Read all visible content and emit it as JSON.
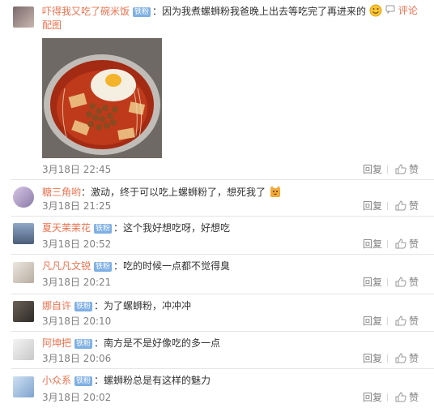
{
  "comments": [
    {
      "username": "吓得我又吃了碗米饭",
      "badge": "铁粉",
      "text": "因为我煮螺蛳粉我爸晚上出去等吃完了再进来的",
      "actions_top": "评论",
      "pic_link": "配图",
      "time": "3月18日 22:45",
      "reply": "回复",
      "like": "赞"
    },
    {
      "username": "糖三角哟",
      "badge": "",
      "text": "激动，终于可以吃上螺蛳粉了，想死我了",
      "time": "3月18日 21:25",
      "reply": "回复",
      "like": "赞"
    },
    {
      "username": "夏天茉茉花",
      "badge": "铁粉",
      "text": "这个我好想吃呀，好想吃",
      "time": "3月18日 20:52",
      "reply": "回复",
      "like": "赞"
    },
    {
      "username": "凡凡凡文锐",
      "badge": "铁粉",
      "text": "吃的时候一点都不觉得臭",
      "time": "3月18日 20:21",
      "reply": "回复",
      "like": "赞"
    },
    {
      "username": "娜自许",
      "badge": "铁粉",
      "text": "为了螺蛳粉，冲冲冲",
      "time": "3月18日 20:10",
      "reply": "回复",
      "like": "赞"
    },
    {
      "username": "阿坤把",
      "badge": "铁粉",
      "text": "南方是不是好像吃的多一点",
      "time": "3月18日 20:06",
      "reply": "回复",
      "like": "赞"
    },
    {
      "username": "小众系",
      "badge": "铁粉",
      "text": "螺蛳粉总是有这样的魅力",
      "time": "3月18日 20:02",
      "reply": "回复",
      "like": "赞"
    }
  ],
  "colors": {
    "username": "#eb7350",
    "badge_bg": "#7fb0e3",
    "meta": "#808080"
  },
  "icons": [
    "comment-icon",
    "thumbs-up-icon",
    "smile-emoji",
    "cat-emoji"
  ]
}
